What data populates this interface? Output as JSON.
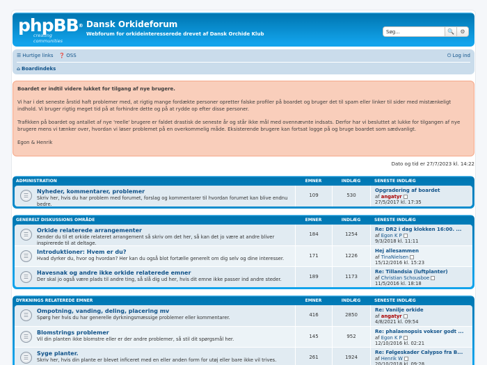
{
  "header": {
    "logo_main": "phpBB",
    "logo_reg": "®",
    "logo_sub": "creating communities",
    "title": "Dansk Orkideforum",
    "description": "Webforum for orkideinteresserede drevet af Dansk Orchide Klub",
    "search_placeholder": "Søg...",
    "search_icon": "🔍",
    "adv_icon": "⚙"
  },
  "navbar": {
    "quicklinks": "Hurtige links",
    "faq": "OSS",
    "login": "Log ind",
    "board_index": "Boardindeks"
  },
  "announcement": {
    "title": "Boardet er indtil videre lukket for tilgang af nye brugere.",
    "p1": "Vi har i det seneste årstid haft problemer med, at rigtig mange fordækte personer opretter falske profiler på boardet og bruger det til spam eller linker til sider med mistænkeligt indhold. Vi bruger rigtig meget tid på at forhindre dette og på at rydde op efter disse personer.",
    "p2": "Trafikken på boardet og antallet af nye 'reelle' brugere er faldet drastisk de seneste år og står ikke mål med ovennævnte indsats. Derfor har vi besluttet at lukke for tilgangen af nye brugere mens vi tænker over, hvordan vi løser problemet på en overkommelig måde. Eksisterende brugere kan fortsat logge på og bruge boardet som sædvanligt.",
    "sign": "Egon & Henrik"
  },
  "datetime": "Dato og tid er 27/7/2023 kl. 14:22",
  "columns": {
    "topics": "Emner",
    "posts": "Indlæg",
    "last": "Seneste indlæg"
  },
  "categories": [
    {
      "name": "Administration",
      "forums": [
        {
          "title": "Nyheder, kommentarer, problemer",
          "desc": "Skriv her, hvis du har problem med forumet, forslag og kommentarer til hvordan forumet kan blive endnu bedre.",
          "topics": "109",
          "posts": "530",
          "last_title": "Opgradering af boardet",
          "last_by": "af",
          "last_user": "angatyr",
          "last_user_style": "admin",
          "last_date": "27/5/2017 kl. 17:35"
        }
      ]
    },
    {
      "name": "Generelt diskussions område",
      "forums": [
        {
          "title": "Orkide relaterede arrangementer",
          "desc": "Kender du til et orkide relateret arrangement så skriv om det her, så kan det jo være at andre bliver inspirerede til at deltage.",
          "topics": "184",
          "posts": "1254",
          "last_title": "Re: DR2 i dag klokken 16:00. ...",
          "last_by": "af",
          "last_user": "Egon K P",
          "last_user_style": "normal",
          "last_date": "9/3/2018 kl. 11:11"
        },
        {
          "title": "Introduktioner: Hvem er du?",
          "desc": "Hvad dyrker du, hvor og hvordan? Her kan du også blot fortælle generelt om dig selv og dine interesser.",
          "topics": "171",
          "posts": "1226",
          "last_title": "Hej allesammen",
          "last_by": "af",
          "last_user": "TinaNielsen",
          "last_user_style": "normal",
          "last_date": "15/12/2016 kl. 15:23"
        },
        {
          "title": "Havesnak og andre ikke orkide relaterede emner",
          "desc": "Der skal jo også være plads til andre ting, så slå dig ud her, hvis dit emne ikke passer ind andre steder.",
          "topics": "189",
          "posts": "1173",
          "last_title": "Re: Tillandsia (luftplanter)",
          "last_by": "af",
          "last_user": "Christian Schousboe",
          "last_user_style": "normal",
          "last_date": "11/5/2016 kl. 18:18"
        }
      ]
    },
    {
      "name": "Dyrknings relaterede emner",
      "forums": [
        {
          "title": "Ompotning, vanding, deling, placering mv",
          "desc": "Spørg her hvis du har generelle dyrkningsmæssige problemer eller kommentarer.",
          "topics": "416",
          "posts": "2850",
          "last_title": "Re: Vanilje orkide",
          "last_by": "af",
          "last_user": "angatyr",
          "last_user_style": "admin",
          "last_date": "4/8/2021 kl. 09:54"
        },
        {
          "title": "Blomstrings problemer",
          "desc": "Vil din planten ikke blomstre eller er der andre problemer, så stil dit spørgsmål her.",
          "topics": "145",
          "posts": "952",
          "last_title": "Re: phalaenopsis vokser godt ...",
          "last_by": "af",
          "last_user": "Egon K P",
          "last_user_style": "normal",
          "last_date": "12/10/2016 kl. 02:21"
        },
        {
          "title": "Syge planter.",
          "desc": "Skriv her, hvis din plante er blevet inficeret med en eller anden form for utøj eller bare ikke vil trives.",
          "topics": "261",
          "posts": "1924",
          "last_title": "Re: Følgeskader Calypso fra B...",
          "last_by": "af",
          "last_user": "Henrik W",
          "last_user_style": "normal",
          "last_date": "20/10/2018 kl. 09:28"
        }
      ]
    }
  ]
}
